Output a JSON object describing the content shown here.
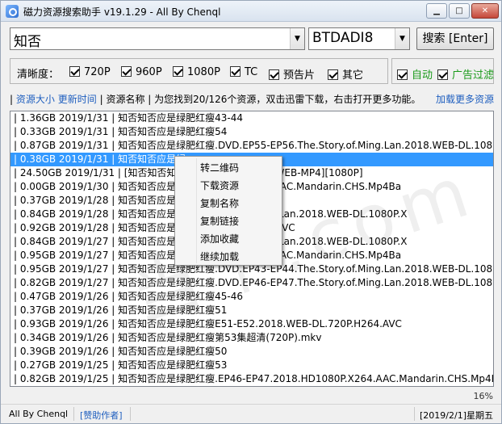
{
  "window": {
    "title": "磁力资源搜索助手 v19.1.29 - All By Chenql",
    "controls": {
      "minimize": "▁",
      "maximize": "□",
      "close": "✕"
    }
  },
  "search": {
    "query": "知否",
    "site": "BTDADI8",
    "button_label": "搜索 [Enter]",
    "dropdown_arrow": "▼"
  },
  "filters": {
    "label": "清晰度：",
    "options": [
      "720P",
      "960P",
      "1080P",
      "TC",
      "预告片",
      "其它"
    ],
    "auto": "自动",
    "ad_filter": "广告过滤"
  },
  "info": {
    "sep": "|",
    "size_link": "资源大小",
    "time_link": "更新时间",
    "name_col": "资源名称",
    "message": "为您找到20/126个资源，双击迅雷下载，右击打开更多功能。",
    "more_link": "加载更多资源"
  },
  "results": [
    "| 1.36GB 2019/1/31 | 知否知否应是绿肥红瘦43-44",
    "| 0.33GB 2019/1/31 | 知否知否应是绿肥红瘦54",
    "| 0.87GB 2019/1/31 | 知否知否应是绿肥红瘦.DVD.EP55-EP56.The.Story.of.Ming.Lan.2018.WEB-DL.1080P.X",
    "| 0.38GB 2019/1/31 | 知否知否应是绿",
    "| 24.50GB 2019/1/31 | [知否知否知                [01-52集][国语中字][WEB-MP4][1080P]",
    "| 0.00GB 2019/1/30 | 知否知否应是绿                 3.HD1080P.X264.AAC.Mandarin.CHS.Mp4Ba",
    "| 0.37GB 2019/1/28 | 知否知否应是绿",
    "| 0.84GB 2019/1/28 | 知否知否应是绿                  .The.Story.of.Ming.Lan.2018.WEB-DL.1080P.X",
    "| 0.92GB 2019/1/28 | 知否知否应是绿                  EB-DL.720P.H264.AVC",
    "| 0.84GB 2019/1/27 | 知否知否应是绿                  .The.Story.of.Ming.Lan.2018.WEB-DL.1080P.X",
    "| 0.95GB 2019/1/27 | 知否知否应是绿                  3.HD1080P.X264.AAC.Mandarin.CHS.Mp4Ba",
    "| 0.95GB 2019/1/27 | 知否知否应是绿肥红瘦.DVD.EP43-EP44.The.Story.of.Ming.Lan.2018.WEB-DL.1080P.X",
    "| 0.82GB 2019/1/27 | 知否知否应是绿肥红瘦.DVD.EP46-EP47.The.Story.of.Ming.Lan.2018.WEB-DL.1080P.X",
    "| 0.47GB 2019/1/26 | 知否知否应是绿肥红瘦45-46",
    "| 0.37GB 2019/1/26 | 知否知否应是绿肥红瘦51",
    "| 0.93GB 2019/1/26 | 知否知否应是绿肥红瘦E51-E52.2018.WEB-DL.720P.H264.AVC",
    "| 0.34GB 2019/1/26 | 知否知否应是绿肥红瘦第53集超清(720P).mkv",
    "| 0.39GB 2019/1/26 | 知否知否应是绿肥红瘦50",
    "| 0.27GB 2019/1/25 | 知否知否应是绿肥红瘦53",
    "| 0.82GB 2019/1/25 | 知否知否应是绿肥红瘦.EP46-EP47.2018.HD1080P.X264.AAC.Mandarin.CHS.Mp4Ba"
  ],
  "context_menu": [
    "转二维码",
    "下载资源",
    "复制名称",
    "复制链接",
    "添加收藏",
    "继续加载"
  ],
  "watermark": "当下.com",
  "zoom": "16%",
  "status": {
    "left": "All By Chenql",
    "author_link": "[赞助作者]",
    "date": "[2019/2/1]星期五"
  }
}
